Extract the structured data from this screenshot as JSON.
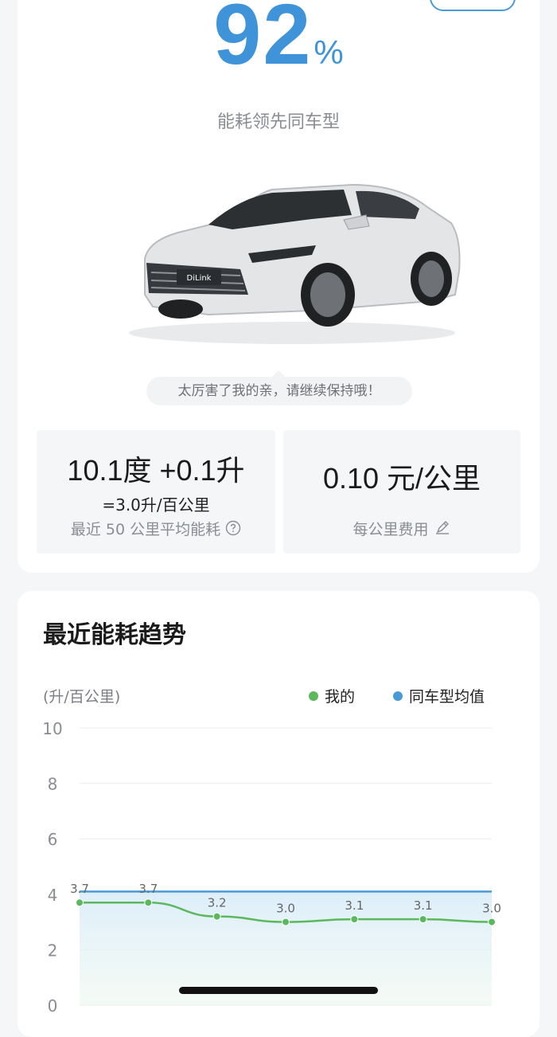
{
  "score": {
    "value": "92",
    "unit": "%",
    "caption": "能耗领先同车型"
  },
  "bubble": {
    "text": "太厉害了我的亲，请继续保持哦！"
  },
  "stats": {
    "left": {
      "main": "10.1度 +0.1升",
      "sub": "=3.0升/百公里",
      "label": "最近 50 公里平均能耗"
    },
    "right": {
      "main": "0.10 元/公里",
      "label": "每公里费用"
    }
  },
  "trend": {
    "title": "最近能耗趋势",
    "unit": "(升/百公里)",
    "legend": {
      "mine": "我的",
      "avg": "同车型均值"
    },
    "colors": {
      "mine": "#5cb85c",
      "avg": "#4a9ad6"
    }
  },
  "chart_data": {
    "type": "line",
    "yticks": [
      "10",
      "8",
      "6",
      "4",
      "2",
      "0"
    ],
    "ylim": [
      0,
      10
    ],
    "grid": true,
    "series": [
      {
        "name": "我的",
        "values": [
          3.7,
          3.7,
          3.2,
          3.0,
          3.1,
          3.1,
          3.0
        ],
        "labels": [
          "3.7",
          "3.7",
          "3.2",
          "3.0",
          "3.1",
          "3.1",
          "3.0"
        ]
      },
      {
        "name": "同车型均值",
        "values": [
          4.1,
          4.1,
          4.1,
          4.1,
          4.1,
          4.1,
          4.1
        ]
      }
    ]
  }
}
